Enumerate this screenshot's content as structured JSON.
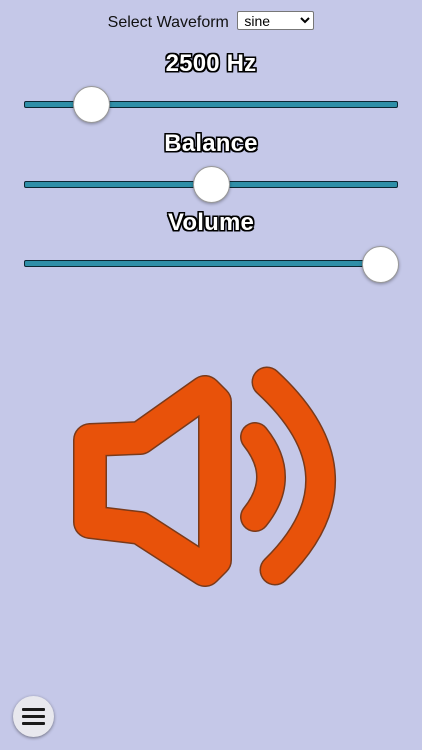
{
  "waveform": {
    "label": "Select Waveform",
    "selected": "sine",
    "options": [
      "sine"
    ]
  },
  "frequency": {
    "label": "2500 Hz",
    "position": 0.145
  },
  "balance": {
    "label": "Balance",
    "position": 0.5
  },
  "volume": {
    "label": "Volume",
    "position": 1.0
  },
  "speaker": {
    "icon": "speaker-volume-icon",
    "fill_color": "#e8520a",
    "stroke_color": "#7a3a1a"
  },
  "menu": {
    "icon": "hamburger-menu-icon"
  }
}
